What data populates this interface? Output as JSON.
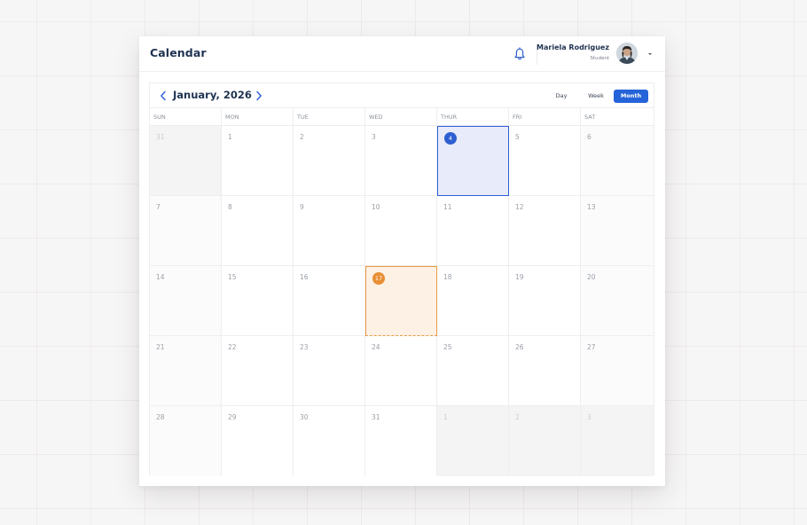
{
  "header": {
    "title": "Calendar",
    "user_name": "Mariela Rodriguez",
    "user_role": "Student"
  },
  "calendar": {
    "month_label": "January, 2026",
    "views": [
      "Day",
      "Week",
      "Month"
    ],
    "active_view": "Month",
    "weekdays": [
      "SUN",
      "MON",
      "TUE",
      "WED",
      "THUR",
      "FRI",
      "SAT"
    ],
    "weeks": [
      [
        "31",
        "1",
        "2",
        "3",
        "4",
        "5",
        "6"
      ],
      [
        "7",
        "8",
        "9",
        "10",
        "11",
        "12",
        "13"
      ],
      [
        "14",
        "15",
        "16",
        "17",
        "18",
        "19",
        "20"
      ],
      [
        "21",
        "22",
        "23",
        "24",
        "25",
        "26",
        "27"
      ],
      [
        "28",
        "29",
        "30",
        "31",
        "1",
        "2",
        "3"
      ]
    ],
    "selected_day": "4",
    "today": "17"
  },
  "icons": {
    "notifications": "bell-icon",
    "menu": "chevron-down-icon",
    "prev": "chevron-left-icon",
    "next": "chevron-right-icon"
  },
  "colors": {
    "accent": "#2563d9",
    "selected_fill": "#e8ebfa",
    "today_accent": "#e88f35",
    "today_fill": "#fdf1e5"
  }
}
